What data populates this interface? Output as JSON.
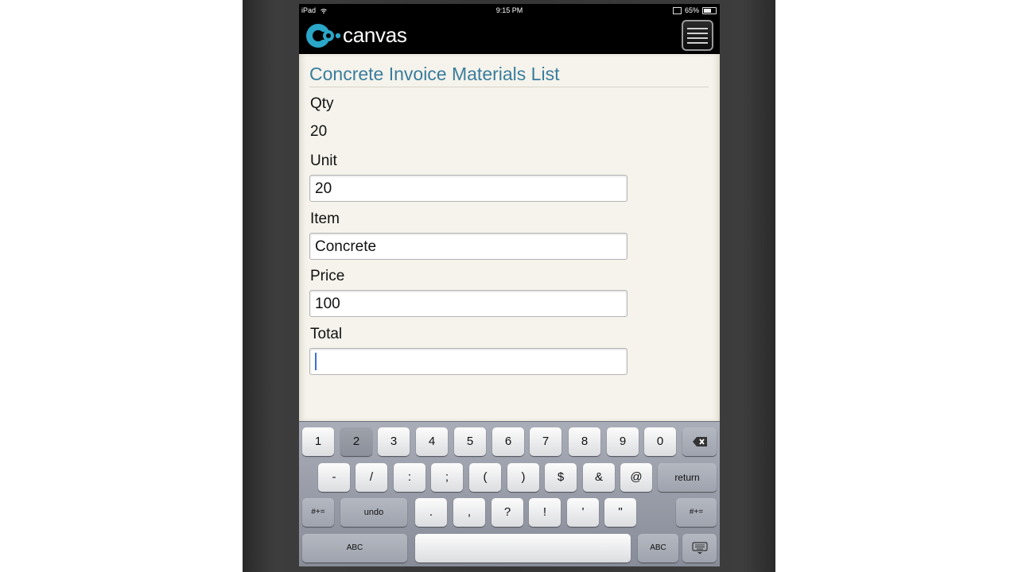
{
  "status_bar": {
    "device": "iPad",
    "time": "9:15 PM",
    "battery": "65%",
    "battery_level": 0.65
  },
  "app_bar": {
    "logo_text": "canvas",
    "menu_icon": "hamburger-menu-icon"
  },
  "form": {
    "title": "Concrete Invoice Materials List",
    "qty_label": "Qty",
    "qty_value": "20",
    "unit_label": "Unit",
    "unit_value": "20",
    "item_label": "Item",
    "item_value": "Concrete",
    "price_label": "Price",
    "price_value": "100",
    "total_label": "Total",
    "total_value": ""
  },
  "keyboard": {
    "row1": [
      "1",
      "2",
      "3",
      "4",
      "5",
      "6",
      "7",
      "8",
      "9",
      "0"
    ],
    "row2": [
      "-",
      "/",
      ":",
      ";",
      "(",
      ")",
      "$",
      "&",
      "@"
    ],
    "return_label": "return",
    "toggle_label": "#+=",
    "undo_label": "undo",
    "row3": [
      ".",
      ",",
      "?",
      "!",
      "'",
      "\""
    ],
    "abc_label": "ABC",
    "backspace_icon": "backspace-icon",
    "hide_keyboard_icon": "keyboard-hide-icon"
  },
  "colors": {
    "brand_blue": "#3a7d9c",
    "logo_accent": "#2aa6c8",
    "caret": "#3b6fd1"
  }
}
